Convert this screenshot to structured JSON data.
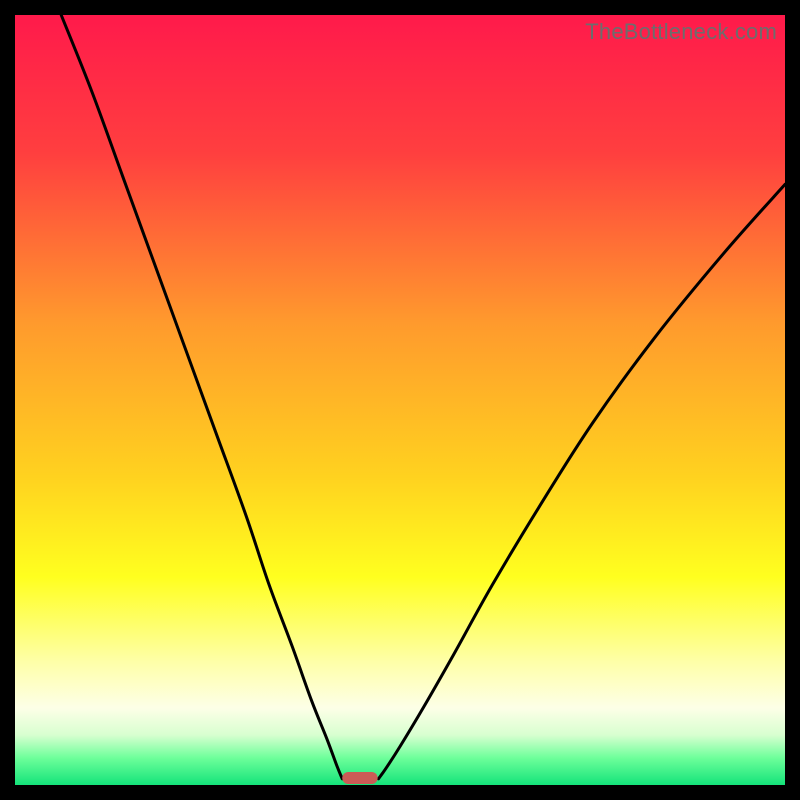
{
  "watermark": "TheBottleneck.com",
  "chart_data": {
    "type": "line",
    "title": "",
    "xlabel": "",
    "ylabel": "",
    "xlim": [
      0,
      100
    ],
    "ylim": [
      0,
      100
    ],
    "gradient_stops": [
      {
        "offset": 0.0,
        "color": "#ff1a4b"
      },
      {
        "offset": 0.18,
        "color": "#ff3f3f"
      },
      {
        "offset": 0.4,
        "color": "#ff9a2d"
      },
      {
        "offset": 0.6,
        "color": "#ffd21f"
      },
      {
        "offset": 0.73,
        "color": "#ffff1f"
      },
      {
        "offset": 0.84,
        "color": "#feffa8"
      },
      {
        "offset": 0.9,
        "color": "#fdffe7"
      },
      {
        "offset": 0.935,
        "color": "#d8ffd0"
      },
      {
        "offset": 0.965,
        "color": "#6dff9a"
      },
      {
        "offset": 1.0,
        "color": "#14e37a"
      }
    ],
    "series": [
      {
        "name": "left-curve",
        "x": [
          6,
          10,
          14,
          18,
          22,
          26,
          30,
          33,
          36,
          38.5,
          40.5,
          41.8,
          42.5
        ],
        "y": [
          100,
          90,
          79,
          68,
          57,
          46,
          35,
          26,
          18,
          11,
          6,
          2.5,
          0.8
        ]
      },
      {
        "name": "right-curve",
        "x": [
          47.2,
          48.2,
          50,
          53,
          57,
          62,
          68,
          75,
          83,
          92,
          100
        ],
        "y": [
          0.8,
          2.2,
          5,
          10,
          17,
          26,
          36,
          47,
          58,
          69,
          78
        ]
      }
    ],
    "marker": {
      "name": "min-marker",
      "x_center": 44.8,
      "width": 4.6,
      "color": "#cb5b56"
    }
  }
}
